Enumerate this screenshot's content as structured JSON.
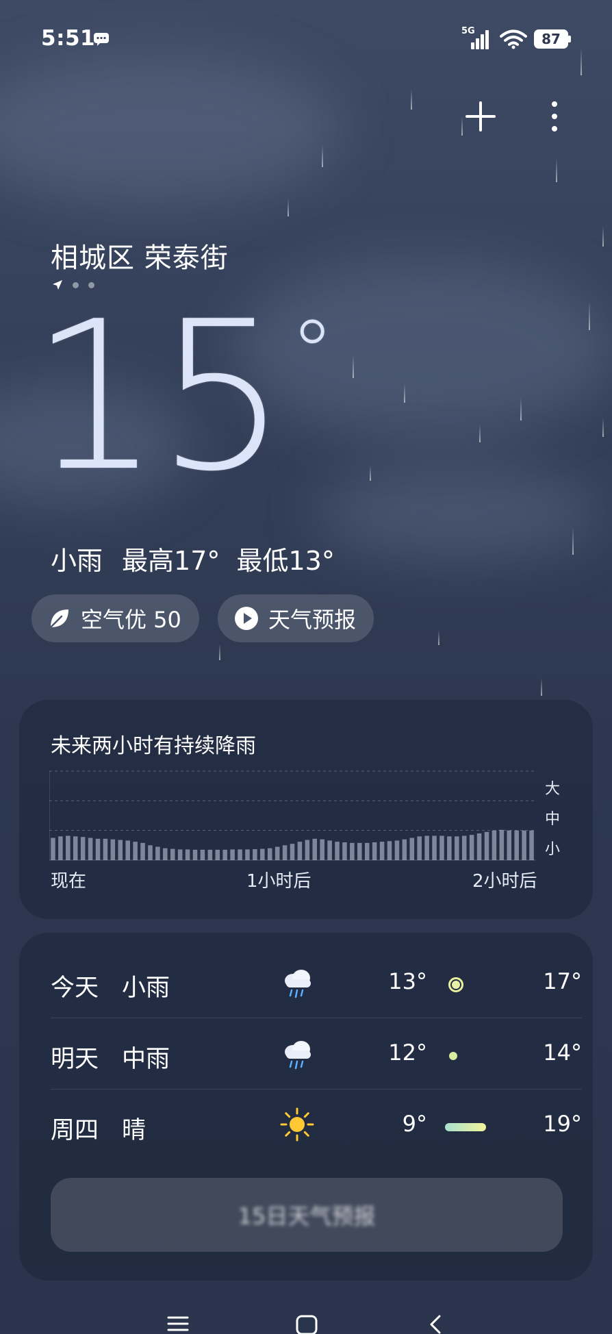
{
  "status_bar": {
    "time": "5:51",
    "network": "5G",
    "battery": "87",
    "icons": [
      "message-icon",
      "signal-icon",
      "wifi-icon",
      "battery-icon"
    ]
  },
  "actions": {
    "add_icon": "plus-icon",
    "more_icon": "more-vertical-icon"
  },
  "location": {
    "name": "相城区 荣泰街",
    "page_count": 3,
    "current_page": 1
  },
  "current": {
    "temperature": "15",
    "degree": "°",
    "condition": "小雨",
    "high": "最高17°",
    "low": "最低13°"
  },
  "chips": {
    "air_quality": "空气优 50",
    "forecast_video": "天气预报"
  },
  "rain_forecast": {
    "title": "未来两小时有持续降雨",
    "x_labels": [
      "现在",
      "1小时后",
      "2小时后"
    ],
    "y_labels": [
      "大",
      "中",
      "小"
    ]
  },
  "chart_data": {
    "type": "bar",
    "title": "未来两小时有持续降雨",
    "xlabel": "",
    "ylabel": "",
    "x_ticks": [
      "现在",
      "1小时后",
      "2小时后"
    ],
    "y_ticks": [
      "小",
      "中",
      "大"
    ],
    "ylim": [
      0,
      3
    ],
    "values": [
      0.75,
      0.8,
      0.82,
      0.8,
      0.78,
      0.75,
      0.72,
      0.72,
      0.7,
      0.68,
      0.66,
      0.62,
      0.58,
      0.5,
      0.45,
      0.4,
      0.38,
      0.36,
      0.36,
      0.35,
      0.35,
      0.35,
      0.35,
      0.35,
      0.36,
      0.36,
      0.36,
      0.37,
      0.38,
      0.4,
      0.45,
      0.5,
      0.55,
      0.62,
      0.68,
      0.72,
      0.7,
      0.66,
      0.62,
      0.6,
      0.58,
      0.58,
      0.58,
      0.6,
      0.62,
      0.64,
      0.66,
      0.7,
      0.75,
      0.8,
      0.82,
      0.82,
      0.82,
      0.8,
      0.8,
      0.82,
      0.85,
      0.9,
      0.95,
      1.0,
      1.02,
      1.0,
      1.0,
      1.0,
      1.0
    ]
  },
  "daily": [
    {
      "day": "今天",
      "condition": "小雨",
      "icon": "light-rain-icon",
      "low": "13°",
      "high": "17°",
      "low_val": 13,
      "high_val": 17,
      "bar_color": "#e8f0a8",
      "is_today": true,
      "current_val": 15
    },
    {
      "day": "明天",
      "condition": "中雨",
      "icon": "moderate-rain-icon",
      "low": "12°",
      "high": "14°",
      "low_val": 12,
      "high_val": 14,
      "bar_color": "#d8eca0",
      "is_today": false
    },
    {
      "day": "周四",
      "condition": "晴",
      "icon": "sun-icon",
      "low": "9°",
      "high": "19°",
      "low_val": 9,
      "high_val": 19,
      "bar_color": "#a8e0c8",
      "is_today": false
    }
  ],
  "daily_range": [
    9,
    19
  ],
  "more_button": "15日天气预报",
  "colors": {
    "background_top": "#3e4a63",
    "background_bottom": "#2a344c",
    "bar_accent": "#e9f19b"
  },
  "nav": {
    "menu_icon": "menu-icon",
    "home_icon": "home-icon",
    "back_icon": "back-icon"
  }
}
